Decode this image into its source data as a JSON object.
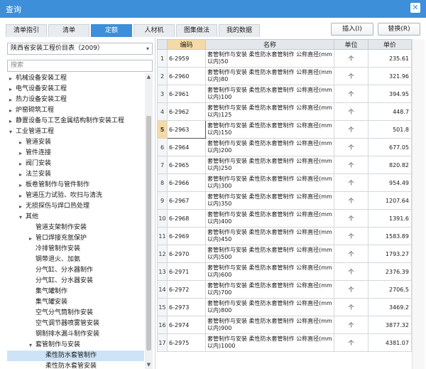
{
  "window": {
    "title": "查询",
    "close_glyph": "✕"
  },
  "tabs": [
    "清单指引",
    "清单",
    "定额",
    "人材机",
    "图集做法",
    "我的数据"
  ],
  "active_tab": 2,
  "buttons": {
    "insert": "插入(I)",
    "replace": "替换(R)"
  },
  "library": {
    "selected": "陕西省安装工程价目表（2009）"
  },
  "search": {
    "placeholder": "搜索"
  },
  "tree": [
    {
      "label": "机械设备安装工程",
      "level": 0,
      "arrow": "▸"
    },
    {
      "label": "电气设备安装工程",
      "level": 0,
      "arrow": "▸"
    },
    {
      "label": "热力设备安装工程",
      "level": 0,
      "arrow": "▸"
    },
    {
      "label": "炉窑砌筑工程",
      "level": 0,
      "arrow": "▸"
    },
    {
      "label": "静置设备与工艺金属结构制作安装工程",
      "level": 0,
      "arrow": "▸"
    },
    {
      "label": "工业管道工程",
      "level": 0,
      "arrow": "▾"
    },
    {
      "label": "管道安装",
      "level": 1,
      "arrow": "▸"
    },
    {
      "label": "管件连接",
      "level": 1,
      "arrow": "▸"
    },
    {
      "label": "阀门安装",
      "level": 1,
      "arrow": "▸"
    },
    {
      "label": "法兰安装",
      "level": 1,
      "arrow": "▸"
    },
    {
      "label": "板卷管制作与管件制作",
      "level": 1,
      "arrow": "▸"
    },
    {
      "label": "管道压力试验、吹扫与清洗",
      "level": 1,
      "arrow": "▸"
    },
    {
      "label": "无损探伤与焊口热处理",
      "level": 1,
      "arrow": "▸"
    },
    {
      "label": "其他",
      "level": 1,
      "arrow": "▾"
    },
    {
      "label": "管道支架制作安装",
      "level": 2,
      "arrow": ""
    },
    {
      "label": "管口焊接充氩保护",
      "level": 2,
      "arrow": "▸"
    },
    {
      "label": "冷排管制作安装",
      "level": 2,
      "arrow": ""
    },
    {
      "label": "钢带退火、加氨",
      "level": 2,
      "arrow": ""
    },
    {
      "label": "分气缸、分水器制作",
      "level": 2,
      "arrow": ""
    },
    {
      "label": "分气缸、分水器安装",
      "level": 2,
      "arrow": ""
    },
    {
      "label": "集气罐制作",
      "level": 2,
      "arrow": ""
    },
    {
      "label": "集气罐安装",
      "level": 2,
      "arrow": ""
    },
    {
      "label": "空气分气筒制作安装",
      "level": 2,
      "arrow": ""
    },
    {
      "label": "空气调节器喷雾管安装",
      "level": 2,
      "arrow": ""
    },
    {
      "label": "钢制排水漏斗制作安装",
      "level": 2,
      "arrow": ""
    },
    {
      "label": "套管制作与安装",
      "level": 2,
      "arrow": "▾"
    },
    {
      "label": "柔性防水套管制作",
      "level": 3,
      "arrow": "",
      "selected": true
    },
    {
      "label": "柔性防水套管安装",
      "level": 3,
      "arrow": ""
    }
  ],
  "grid": {
    "headers": [
      "编码",
      "名称",
      "单位",
      "单价"
    ],
    "current_row": 4,
    "rows": [
      {
        "no": "1",
        "code": "6-2959",
        "name": "套管制作与安装 柔性防水套管制作 公称直径(mm以内)50",
        "unit": "个",
        "price": "235.61"
      },
      {
        "no": "2",
        "code": "6-2960",
        "name": "套管制作与安装 柔性防水套管制作 公称直径(mm以内)80",
        "unit": "个",
        "price": "321.96"
      },
      {
        "no": "3",
        "code": "6-2961",
        "name": "套管制作与安装 柔性防水套管制作 公称直径(mm以内)100",
        "unit": "个",
        "price": "394.95"
      },
      {
        "no": "4",
        "code": "6-2962",
        "name": "套管制作与安装 柔性防水套管制作 公称直径(mm以内)125",
        "unit": "个",
        "price": "448.7"
      },
      {
        "no": "5",
        "code": "6-2963",
        "name": "套管制作与安装 柔性防水套管制作 公称直径(mm以内)150",
        "unit": "个",
        "price": "501.8"
      },
      {
        "no": "6",
        "code": "6-2964",
        "name": "套管制作与安装 柔性防水套管制作 公称直径(mm以内)200",
        "unit": "个",
        "price": "677.05"
      },
      {
        "no": "7",
        "code": "6-2965",
        "name": "套管制作与安装 柔性防水套管制作 公称直径(mm以内)250",
        "unit": "个",
        "price": "820.82"
      },
      {
        "no": "8",
        "code": "6-2966",
        "name": "套管制作与安装 柔性防水套管制作 公称直径(mm以内)300",
        "unit": "个",
        "price": "954.49"
      },
      {
        "no": "9",
        "code": "6-2967",
        "name": "套管制作与安装 柔性防水套管制作 公称直径(mm以内)350",
        "unit": "个",
        "price": "1207.64"
      },
      {
        "no": "10",
        "code": "6-2968",
        "name": "套管制作与安装 柔性防水套管制作 公称直径(mm以内)400",
        "unit": "个",
        "price": "1391.6"
      },
      {
        "no": "11",
        "code": "6-2969",
        "name": "套管制作与安装 柔性防水套管制作 公称直径(mm以内)450",
        "unit": "个",
        "price": "1583.89"
      },
      {
        "no": "12",
        "code": "6-2970",
        "name": "套管制作与安装 柔性防水套管制作 公称直径(mm以内)500",
        "unit": "个",
        "price": "1793.27"
      },
      {
        "no": "13",
        "code": "6-2971",
        "name": "套管制作与安装 柔性防水套管制作 公称直径(mm以内)600",
        "unit": "个",
        "price": "2376.39"
      },
      {
        "no": "14",
        "code": "6-2972",
        "name": "套管制作与安装 柔性防水套管制作 公称直径(mm以内)700",
        "unit": "个",
        "price": "2706.5"
      },
      {
        "no": "15",
        "code": "6-2973",
        "name": "套管制作与安装 柔性防水套管制作 公称直径(mm以内)800",
        "unit": "个",
        "price": "3469.2"
      },
      {
        "no": "16",
        "code": "6-2974",
        "name": "套管制作与安装 柔性防水套管制作 公称直径(mm以内)900",
        "unit": "个",
        "price": "3877.32"
      },
      {
        "no": "17",
        "code": "6-2975",
        "name": "套管制作与安装 柔性防水套管制作 公称直径(mm以内)1000",
        "unit": "个",
        "price": "4381.07"
      }
    ]
  },
  "colors": {
    "accent": "#3c8fd8",
    "code_header": "#f5d9a6",
    "tree_selected": "#cde4f7"
  },
  "icons": {
    "close": "close-icon",
    "dropdown": "chevron-down-icon",
    "tree_collapsed": "chevron-right-icon",
    "tree_expanded": "chevron-down-icon"
  }
}
